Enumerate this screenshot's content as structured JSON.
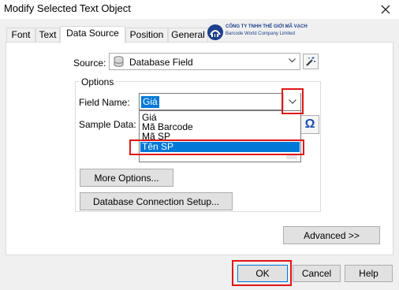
{
  "window": {
    "title": "Modify Selected Text Object"
  },
  "tabs": [
    {
      "label": "Font"
    },
    {
      "label": "Text"
    },
    {
      "label": "Data Source"
    },
    {
      "label": "Position"
    },
    {
      "label": "General"
    }
  ],
  "active_tab": "Data Source",
  "logo": {
    "line1": "CÔNG TY TNHH THẾ GIỚI MÃ VẠCH",
    "line2": "Barcode World Company Limited"
  },
  "source": {
    "label": "Source:",
    "value": "Database Field",
    "icon": "database-icon"
  },
  "options": {
    "title": "Options",
    "field_name_label": "Field Name:",
    "field_name_value": "Giá",
    "sample_data_label": "Sample Data:",
    "dropdown_items": [
      "Giá",
      "Mã Barcode",
      "Mã SP",
      "Tên SP"
    ],
    "dropdown_selected": "Tên SP"
  },
  "buttons": {
    "more_options": "More Options...",
    "db_connection": "Database Connection Setup...",
    "advanced": "Advanced >>",
    "ok": "OK",
    "cancel": "Cancel",
    "help": "Help"
  },
  "colors": {
    "highlight": "#e01616",
    "selection": "#0078d7"
  }
}
